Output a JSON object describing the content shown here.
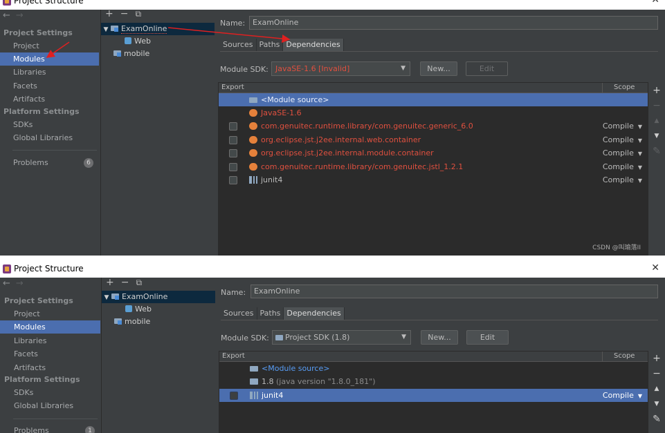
{
  "screens": [
    {
      "window_title": "Project Structure",
      "nav_back": "←",
      "nav_forward": "→",
      "project_settings_header": "Project Settings",
      "project_settings": [
        "Project",
        "Modules",
        "Libraries",
        "Facets",
        "Artifacts"
      ],
      "platform_settings_header": "Platform Settings",
      "platform_settings": [
        "SDKs",
        "Global Libraries"
      ],
      "problems_label": "Problems",
      "problems_count": "6",
      "tree_toolbar": {
        "add": "+",
        "remove": "−",
        "copy": "⧉"
      },
      "tree": [
        "ExamOnline",
        "Web",
        "mobile"
      ],
      "name_label": "Name:",
      "name_value": "ExamOnline",
      "tabs": [
        "Sources",
        "Paths",
        "Dependencies"
      ],
      "sdk_label": "Module SDK:",
      "sdk_value": "JavaSE-1.6 [Invalid]",
      "new_button": "New...",
      "edit_button": "Edit",
      "col_export": "Export",
      "col_scope": "Scope",
      "dependencies": [
        {
          "name": "<Module source>",
          "scope": ""
        },
        {
          "name": "JavaSE-1.6",
          "scope": ""
        },
        {
          "name": "com.genuitec.runtime.library/com.genuitec.generic_6.0",
          "scope": "Compile"
        },
        {
          "name": "org.eclipse.jst.j2ee.internal.web.container",
          "scope": "Compile"
        },
        {
          "name": "org.eclipse.jst.j2ee.internal.module.container",
          "scope": "Compile"
        },
        {
          "name": "com.genuitec.runtime.library/com.genuitec.jstl_1.2.1",
          "scope": "Compile"
        },
        {
          "name": "junit4",
          "scope": "Compile"
        }
      ],
      "tools": {
        "add": "+",
        "remove": "−",
        "up": "▲",
        "down": "▼",
        "edit": "✎"
      },
      "watermark": "CSDN @叫瑜落II"
    },
    {
      "window_title": "Project Structure",
      "nav_back": "←",
      "nav_forward": "→",
      "project_settings_header": "Project Settings",
      "project_settings": [
        "Project",
        "Modules",
        "Libraries",
        "Facets",
        "Artifacts"
      ],
      "platform_settings_header": "Platform Settings",
      "platform_settings": [
        "SDKs",
        "Global Libraries"
      ],
      "problems_label": "Problems",
      "problems_count": "1",
      "tree_toolbar": {
        "add": "+",
        "remove": "−",
        "copy": "⧉"
      },
      "tree": [
        "ExamOnline",
        "Web",
        "mobile"
      ],
      "name_label": "Name:",
      "name_value": "ExamOnline",
      "tabs": [
        "Sources",
        "Paths",
        "Dependencies"
      ],
      "sdk_label": "Module SDK:",
      "sdk_value": "Project SDK (1.8)",
      "new_button": "New...",
      "edit_button": "Edit",
      "col_export": "Export",
      "col_scope": "Scope",
      "dependencies": [
        {
          "name": "<Module source>",
          "extra": "",
          "scope": ""
        },
        {
          "name": "1.8",
          "extra": " (java version \"1.8.0_181\")",
          "scope": ""
        },
        {
          "name": "junit4",
          "extra": "",
          "scope": "Compile"
        }
      ],
      "tools": {
        "add": "+",
        "remove": "−",
        "up": "▲",
        "down": "▼",
        "edit": "✎"
      }
    }
  ],
  "colors": {
    "panel_bg": "#3c3f41",
    "table_bg": "#2b2b2b",
    "selection": "#4b6eaf",
    "error_text": "#e0503f",
    "link_text": "#589df6",
    "annotation_arrow": "#e02020"
  }
}
